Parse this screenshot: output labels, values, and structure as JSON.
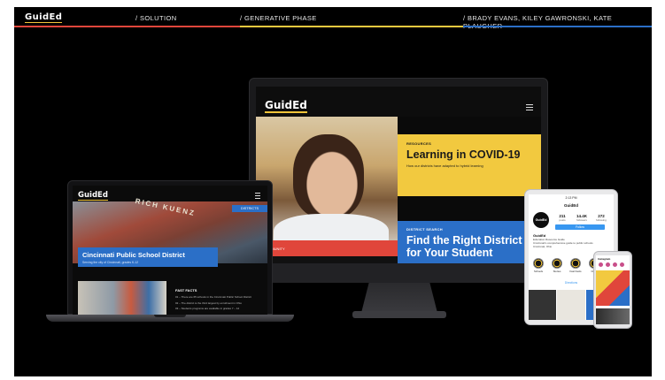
{
  "header": {
    "logo": "GuidEd",
    "section_solution": "/ SOLUTION",
    "section_phase": "/ GENERATIVE PHASE",
    "authors": "/ BRADY EVANS, KILEY GAWRONSKI, KATE PLAUGHER",
    "accent_colors": [
      "#e0463b",
      "#f2c93f",
      "#2b6fc7"
    ]
  },
  "imac": {
    "brand": "GuidEd",
    "resources_tag": "RESOURCES",
    "resources_title": "Learning in COVID-19",
    "resources_sub": "How our districts have adapted to hybrid learning",
    "search_tag": "DISTRICT SEARCH",
    "search_title": "Find the Right District for Your Student",
    "red_strip_text": "COMMUNITY"
  },
  "laptop": {
    "brand": "GuidEd",
    "districts_tag": "DISTRICTS",
    "sign_text": "RICH KUENZ",
    "district_title": "Cincinnati Public School District",
    "district_sub": "Serving the city of Cincinnati, grades K-12",
    "facts_title": "FAST FACTS",
    "facts": [
      "01 – There are 65 schools in the Cincinnati Public School District",
      "02 – The district is the third largest by enrollment in Ohio",
      "03 – Students programs are available in grades 7 – 12"
    ]
  },
  "tablet": {
    "time": "2:13 PM",
    "username": "GuidEd",
    "avatar_text": "GuidEd",
    "stats": [
      {
        "num": "211",
        "label": "posts"
      },
      {
        "num": "14.4K",
        "label": "followers"
      },
      {
        "num": "272",
        "label": "following"
      }
    ],
    "follow_label": "Follow",
    "bio_name": "GuidEd",
    "bio_lines": [
      "Education Resource Guide",
      "Cincinnati's comprehensive guide to public schools",
      "Cincinnati, Ohio"
    ],
    "highlights": [
      "Schools",
      "Stories",
      "Fast Facts",
      "Cincy"
    ],
    "directions": "Directions"
  },
  "phone": {
    "title": "Instagram"
  }
}
